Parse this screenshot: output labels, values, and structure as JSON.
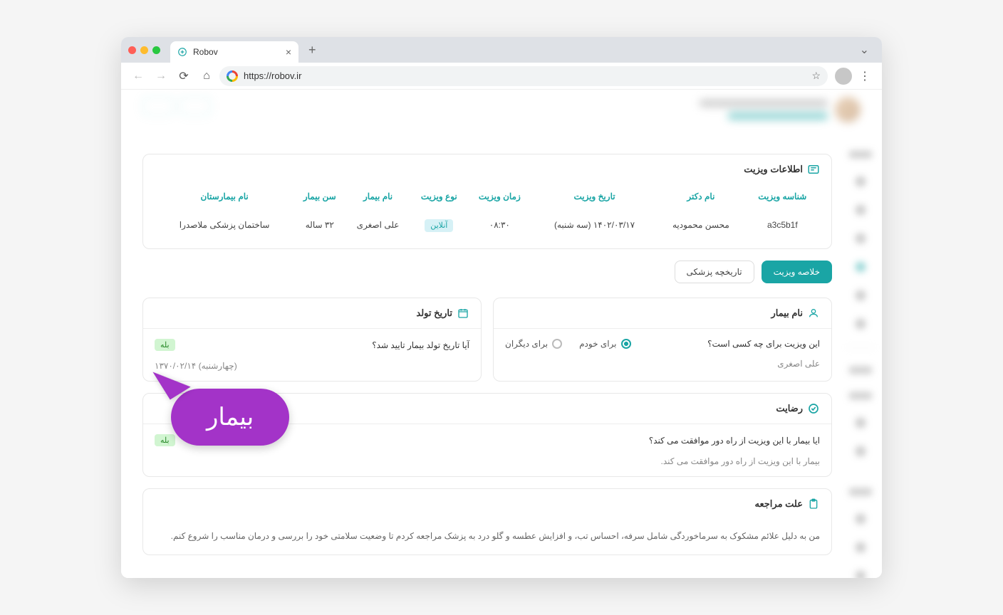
{
  "browser": {
    "tab_title": "Robov",
    "url": "https://robov.ir"
  },
  "visit_info": {
    "title": "اطلاعات ویزیت",
    "headers": [
      "شناسه ویزیت",
      "نام دکتر",
      "تاریخ ویزیت",
      "زمان ویزیت",
      "نوع ویزیت",
      "نام بیمار",
      "سن بیمار",
      "نام بیمارستان"
    ],
    "row": {
      "visit_id": "a3c5b1f",
      "doctor": "محسن محمودیه",
      "date": "۱۴۰۲/۰۳/۱۷ (سه شنبه)",
      "time": "۰۸:۳۰",
      "type": "آنلاین",
      "patient": "علی اصغری",
      "age": "۳۲ ساله",
      "hospital": "ساختمان پزشکی ملاصدرا"
    }
  },
  "tabs": {
    "summary": "خلاصه ویزیت",
    "history": "تاریخچه پزشکی"
  },
  "patient_card": {
    "title": "نام بیمار",
    "question": "این ویزیت برای چه کسی است؟",
    "opt_self": "برای خودم",
    "opt_other": "برای دیگران",
    "name": "علی اصغری"
  },
  "dob_card": {
    "title": "تاریخ تولد",
    "question": "آیا تاریخ تولد بیمار تایید شد؟",
    "badge": "بله",
    "value": "۱۳۷۰/۰۲/۱۴ (چهارشنبه)"
  },
  "consent_card": {
    "title": "رضایت",
    "question": "ایا بیمار با این ویزیت از راه دور موافقت می کند؟",
    "badge": "بله",
    "text": "بیمار با این ویزیت از راه دور موافقت می کند."
  },
  "reason_card": {
    "title": "علت مراجعه",
    "text": "من به دلیل علائم مشکوک به سرماخوردگی شامل سرفه، احساس تب، و افزایش عطسه و گلو درد به پزشک مراجعه کردم تا وضعیت سلامتی خود را بررسی و درمان مناسب را شروع کنم."
  },
  "cursor_label": "بیمار"
}
